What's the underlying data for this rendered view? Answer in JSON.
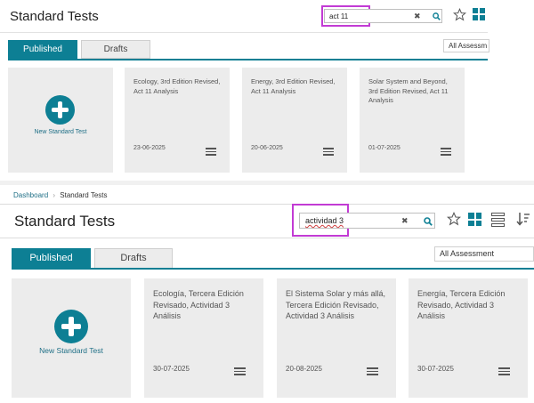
{
  "top": {
    "title": "Standard Tests",
    "search_value": "act 11",
    "tabs": [
      "Published",
      "Drafts"
    ],
    "dropdown": "All Assessm",
    "new_test_label": "New Standard Test",
    "cards": [
      {
        "title": "Ecology, 3rd Edition Revised, Act 11 Analysis",
        "date": "23-06-2025"
      },
      {
        "title": "Energy, 3rd Edition Revised, Act 11 Analysis",
        "date": "20-06-2025"
      },
      {
        "title": "Solar System and Beyond, 3rd Edition Revised, Act 11 Analysis",
        "date": "01-07-2025"
      }
    ]
  },
  "bottom": {
    "breadcrumb": [
      "Dashboard",
      "Standard Tests"
    ],
    "title": "Standard Tests",
    "search_value": "actividad 3",
    "tabs": [
      "Published",
      "Drafts"
    ],
    "dropdown": "All Assessment",
    "new_test_label": "New Standard Test",
    "cards": [
      {
        "title": "Ecología, Tercera Edición Revisado, Actividad 3 Análisis",
        "date": "30-07-2025"
      },
      {
        "title": "El Sistema Solar y más allá, Tercera Edición Revisado, Actividad 3 Análisis",
        "date": "20-08-2025"
      },
      {
        "title": "Energía, Tercera Edición Revisado, Actividad 3 Análisis",
        "date": "30-07-2025"
      }
    ]
  },
  "colors": {
    "accent": "#0d7f94",
    "highlight": "#c23bd4",
    "card_bg": "#ececec"
  },
  "icons": [
    "search-icon",
    "clear-icon",
    "star-icon",
    "grid-view-icon",
    "list-view-icon",
    "sort-icon",
    "plus-circle-icon",
    "menu-icon"
  ]
}
